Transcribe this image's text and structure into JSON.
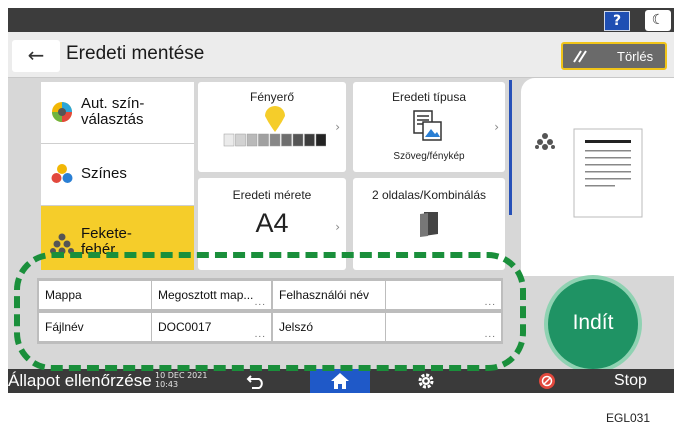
{
  "header": {
    "help_label": "?",
    "title": "Eredeti mentése",
    "back_label": "←",
    "clear_label": "Törlés"
  },
  "color_modes": [
    {
      "label": "Aut. szín-\nválasztás",
      "selected": false
    },
    {
      "label": "Színes",
      "selected": false
    },
    {
      "label": "Fekete-\nfehér",
      "selected": true
    }
  ],
  "tiles": {
    "brightness": {
      "label": "Fényerő",
      "level_index": 4,
      "levels": 9
    },
    "original_type": {
      "label": "Eredeti típusa",
      "value": "Szöveg/fénykép"
    },
    "original_size": {
      "label": "Eredeti mérete",
      "value": "A4"
    },
    "duplex": {
      "label": "2 oldalas/Kombinálás"
    }
  },
  "info_table": {
    "rows": [
      [
        {
          "label": "Mappa",
          "dots": ""
        },
        {
          "label": "Megosztott map...",
          "dots": "..."
        },
        {
          "label": "Felhasználói név",
          "dots": ""
        },
        {
          "label": "",
          "dots": "..."
        }
      ],
      [
        {
          "label": "Fájlnév",
          "dots": ""
        },
        {
          "label": "DOC0017",
          "dots": "..."
        },
        {
          "label": "Jelszó",
          "dots": ""
        },
        {
          "label": "",
          "dots": "..."
        }
      ]
    ]
  },
  "start_label": "Indít",
  "status_bar": {
    "status_check_label": "Állapot ellenőrzése",
    "date": "10 DEC 2021",
    "time": "10:43",
    "stop_label": "Stop"
  },
  "caption": "EGL031",
  "colors": {
    "accent_yellow": "#f5cd2a",
    "start_green": "#1f9364",
    "home_blue": "#1f59c8",
    "callout_green": "#1a8f3b"
  }
}
